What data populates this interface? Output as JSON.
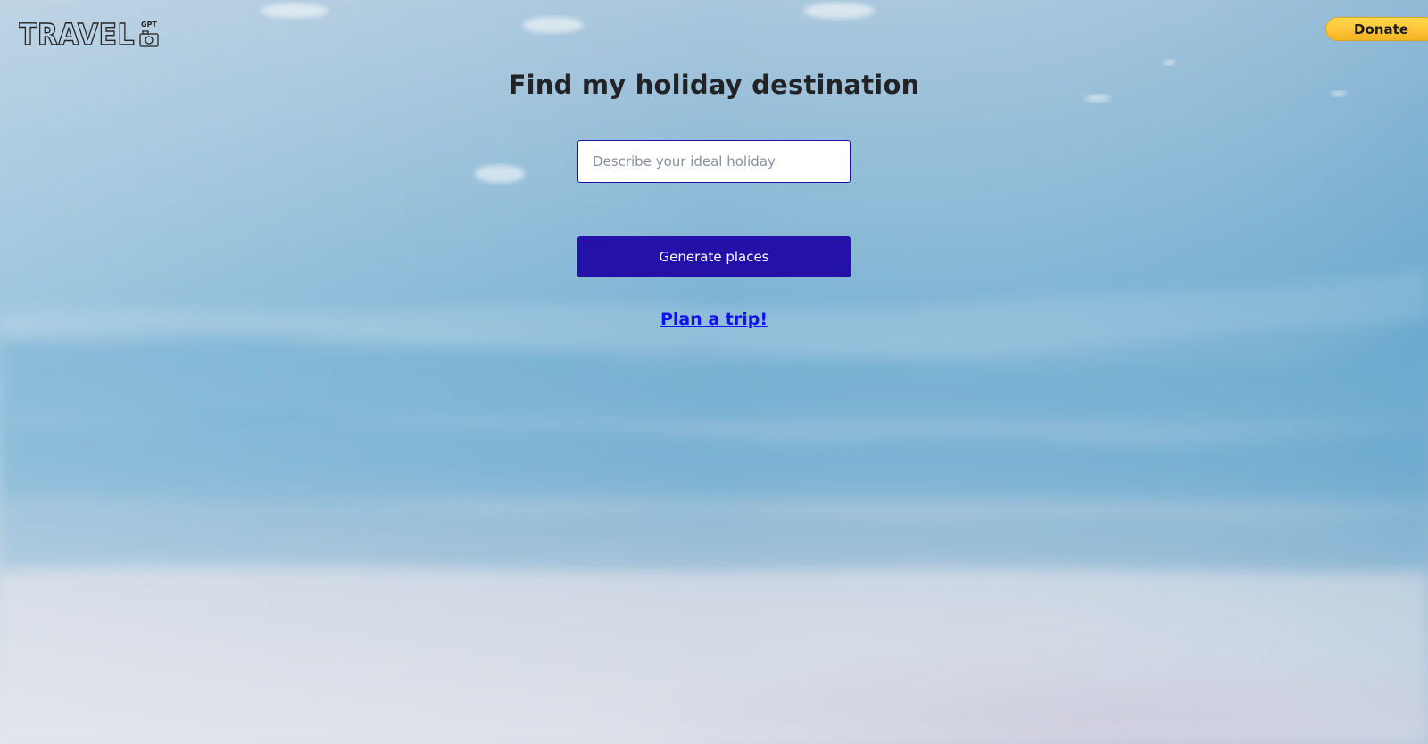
{
  "brand": {
    "logo_text": "TRAVEL",
    "logo_suffix": "GPT",
    "logo_icon": "camera-icon"
  },
  "header": {
    "donate_label": "Donate"
  },
  "main": {
    "title": "Find my holiday destination",
    "search": {
      "placeholder": "Describe your ideal holiday",
      "value": ""
    },
    "generate_label": "Generate places",
    "plan_link_label": "Plan a trip!"
  },
  "colors": {
    "primary_button": "#2411a8",
    "input_border": "#2110a6",
    "link": "#1212ef",
    "donate": "#ffc439",
    "title": "#222326"
  }
}
